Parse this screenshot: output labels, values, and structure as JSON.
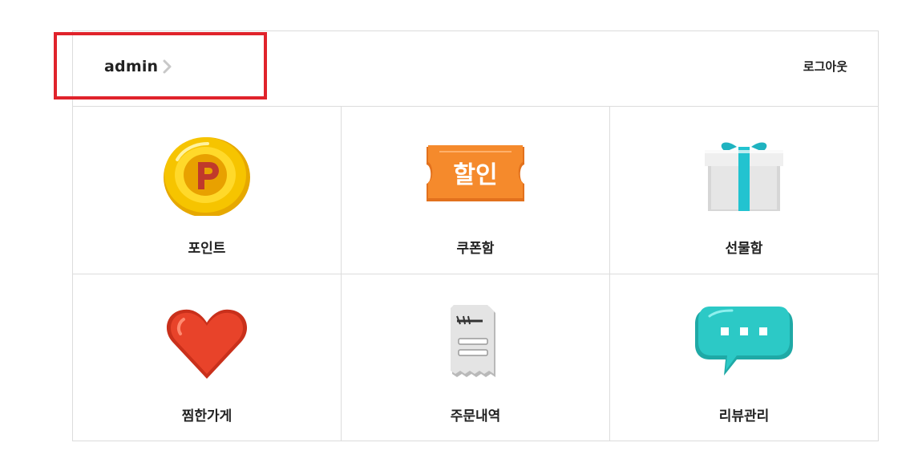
{
  "header": {
    "username": "admin",
    "logout_label": "로그아웃"
  },
  "menu": {
    "items": [
      {
        "label": "포인트",
        "icon": "point-coin-icon"
      },
      {
        "label": "쿠폰함",
        "icon": "coupon-ticket-icon",
        "icon_text": "할인"
      },
      {
        "label": "선물함",
        "icon": "gift-box-icon"
      },
      {
        "label": "찜한가게",
        "icon": "heart-icon"
      },
      {
        "label": "주문내역",
        "icon": "receipt-icon"
      },
      {
        "label": "리뷰관리",
        "icon": "speech-bubble-icon"
      }
    ]
  },
  "colors": {
    "highlight_border": "#e0232b",
    "divider": "#dcdcdc",
    "coin": "#f6c400",
    "coupon": "#f58a2c",
    "gift_ribbon": "#22c3d0",
    "heart": "#e8432a",
    "bubble": "#2cc9c6"
  }
}
